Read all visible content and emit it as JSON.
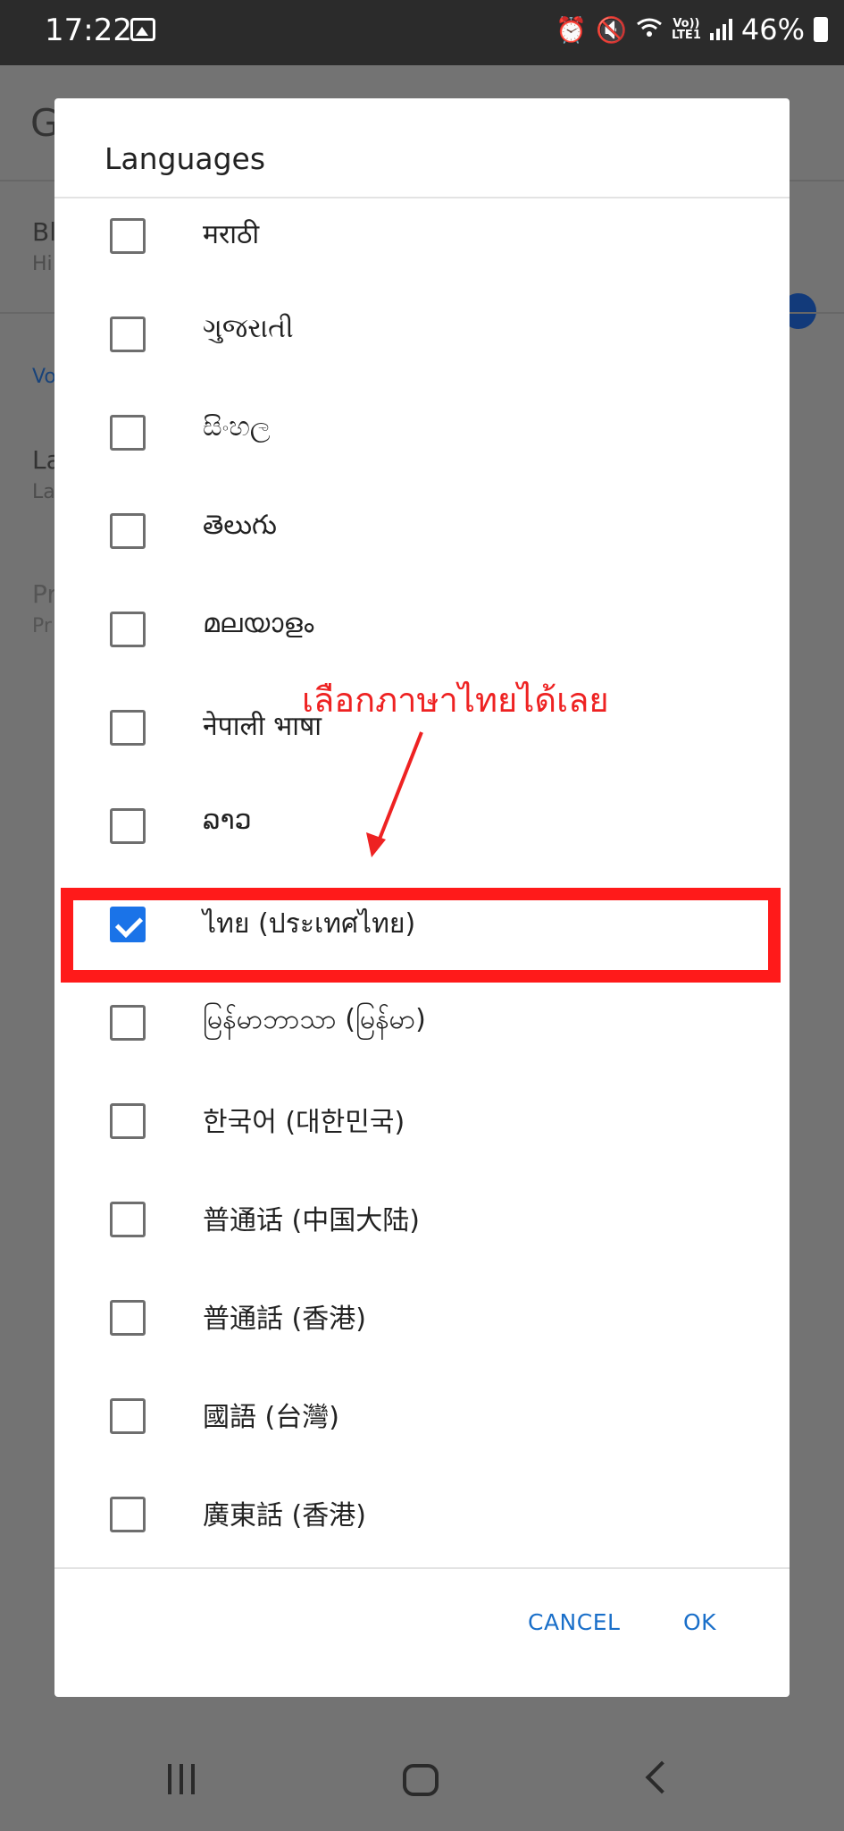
{
  "status_bar": {
    "time": "17:22",
    "lte_top": "Vo))",
    "lte_bottom": "LTE1",
    "battery": "46%"
  },
  "background": {
    "fragments": [
      "G",
      "Bl",
      "Hi",
      "Vo",
      "La",
      "La",
      "Pr",
      "Pr"
    ]
  },
  "dialog": {
    "title": "Languages",
    "languages": [
      {
        "label": "मराठी",
        "checked": false
      },
      {
        "label": "ગુજરાતી",
        "checked": false
      },
      {
        "label": "සිංහල",
        "checked": false
      },
      {
        "label": "తెలుగు",
        "checked": false
      },
      {
        "label": "മലയാളം",
        "checked": false
      },
      {
        "label": "नेपाली भाषा",
        "checked": false
      },
      {
        "label": "ລາວ",
        "checked": false
      },
      {
        "label": "ไทย (ประเทศไทย)",
        "checked": true
      },
      {
        "label": "မြန်မာဘာသာ (မြန်မာ)",
        "checked": false
      },
      {
        "label": "한국어 (대한민국)",
        "checked": false
      },
      {
        "label": "普通话 (中国大陆)",
        "checked": false
      },
      {
        "label": "普通話 (香港)",
        "checked": false
      },
      {
        "label": "國語 (台灣)",
        "checked": false
      },
      {
        "label": "廣東話 (香港)",
        "checked": false
      }
    ],
    "cancel_label": "CANCEL",
    "ok_label": "OK"
  },
  "annotation": {
    "text": "เลือกภาษาไทยได้เลย",
    "color": "#ee2222",
    "highlight_color": "#ff1a1a"
  },
  "colors": {
    "accent": "#1a73e8",
    "button_text": "#1a6fc9"
  }
}
